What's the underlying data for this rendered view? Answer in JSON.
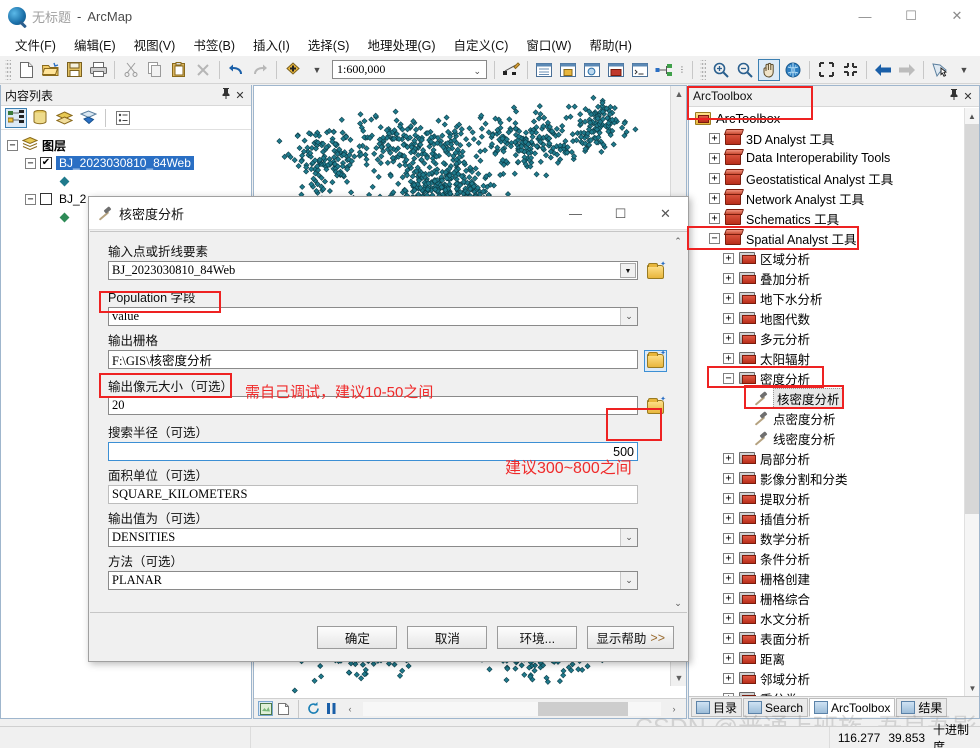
{
  "window": {
    "doc_title": "无标题",
    "app_title": "ArcMap",
    "separator": "-",
    "minimize": "—",
    "maximize": "☐",
    "close": "✕"
  },
  "menubar": {
    "items": [
      {
        "label": "文件(F)"
      },
      {
        "label": "编辑(E)"
      },
      {
        "label": "视图(V)"
      },
      {
        "label": "书签(B)"
      },
      {
        "label": "插入(I)"
      },
      {
        "label": "选择(S)"
      },
      {
        "label": "地理处理(G)"
      },
      {
        "label": "自定义(C)"
      },
      {
        "label": "窗口(W)"
      },
      {
        "label": "帮助(H)"
      }
    ]
  },
  "toolbar": {
    "scale_value": "1:600,000",
    "overflow": "⋮"
  },
  "toc": {
    "title": "内容列表",
    "pin": "📌",
    "close": "✕",
    "root": "图层",
    "layers": [
      {
        "name": "BJ_2023030810_84Web",
        "checked": true,
        "selected": true
      },
      {
        "name": "BJ_2",
        "checked": false,
        "selected": false
      }
    ]
  },
  "map": {
    "bottom_buttons": [
      "layout-view",
      "data-view",
      "refresh",
      "pause"
    ],
    "scroll_left": "‹",
    "scroll_right": "›"
  },
  "arctoolbox": {
    "title": "ArcToolbox",
    "pin": "📌",
    "close": "✕",
    "root": "ArcToolbox",
    "nodes": [
      {
        "label": "3D Analyst 工具",
        "type": "toolbox",
        "indent": 1,
        "expander": "+"
      },
      {
        "label": "Data Interoperability Tools",
        "type": "toolbox",
        "indent": 1,
        "expander": "+"
      },
      {
        "label": "Geostatistical Analyst 工具",
        "type": "toolbox",
        "indent": 1,
        "expander": "+"
      },
      {
        "label": "Network Analyst 工具",
        "type": "toolbox",
        "indent": 1,
        "expander": "+"
      },
      {
        "label": "Schematics 工具",
        "type": "toolbox",
        "indent": 1,
        "expander": "+"
      },
      {
        "label": "Spatial Analyst 工具",
        "type": "toolbox",
        "indent": 1,
        "expander": "-"
      },
      {
        "label": "区域分析",
        "type": "toolset",
        "indent": 2,
        "expander": "+"
      },
      {
        "label": "叠加分析",
        "type": "toolset",
        "indent": 2,
        "expander": "+"
      },
      {
        "label": "地下水分析",
        "type": "toolset",
        "indent": 2,
        "expander": "+"
      },
      {
        "label": "地图代数",
        "type": "toolset",
        "indent": 2,
        "expander": "+"
      },
      {
        "label": "多元分析",
        "type": "toolset",
        "indent": 2,
        "expander": "+"
      },
      {
        "label": "太阳辐射",
        "type": "toolset",
        "indent": 2,
        "expander": "+"
      },
      {
        "label": "密度分析",
        "type": "toolset",
        "indent": 2,
        "expander": "-"
      },
      {
        "label": "核密度分析",
        "type": "tool",
        "indent": 3,
        "expander": "",
        "selected": true
      },
      {
        "label": "点密度分析",
        "type": "tool",
        "indent": 3,
        "expander": ""
      },
      {
        "label": "线密度分析",
        "type": "tool",
        "indent": 3,
        "expander": ""
      },
      {
        "label": "局部分析",
        "type": "toolset",
        "indent": 2,
        "expander": "+"
      },
      {
        "label": "影像分割和分类",
        "type": "toolset",
        "indent": 2,
        "expander": "+"
      },
      {
        "label": "提取分析",
        "type": "toolset",
        "indent": 2,
        "expander": "+"
      },
      {
        "label": "插值分析",
        "type": "toolset",
        "indent": 2,
        "expander": "+"
      },
      {
        "label": "数学分析",
        "type": "toolset",
        "indent": 2,
        "expander": "+"
      },
      {
        "label": "条件分析",
        "type": "toolset",
        "indent": 2,
        "expander": "+"
      },
      {
        "label": "栅格创建",
        "type": "toolset",
        "indent": 2,
        "expander": "+"
      },
      {
        "label": "栅格综合",
        "type": "toolset",
        "indent": 2,
        "expander": "+"
      },
      {
        "label": "水文分析",
        "type": "toolset",
        "indent": 2,
        "expander": "+"
      },
      {
        "label": "表面分析",
        "type": "toolset",
        "indent": 2,
        "expander": "+"
      },
      {
        "label": "距离",
        "type": "toolset",
        "indent": 2,
        "expander": "+"
      },
      {
        "label": "邻域分析",
        "type": "toolset",
        "indent": 2,
        "expander": "+"
      },
      {
        "label": "重分类",
        "type": "toolset",
        "indent": 2,
        "expander": "+"
      }
    ],
    "tabs": [
      {
        "label": "目录",
        "active": false
      },
      {
        "label": "Search",
        "active": false
      },
      {
        "label": "ArcToolbox",
        "active": true
      },
      {
        "label": "结果",
        "active": false
      }
    ]
  },
  "dialog": {
    "title": "核密度分析",
    "minimize": "—",
    "maximize": "☐",
    "close": "✕",
    "fields": [
      {
        "label": "输入点或折线要素",
        "value": "BJ_2023030810_84Web",
        "control": "combo-solid",
        "browse": "normal"
      },
      {
        "label": "Population 字段",
        "value": "value",
        "control": "combo-chev",
        "browse": "none"
      },
      {
        "label": "输出栅格",
        "value": "F:\\GIS\\核密度分析",
        "control": "text",
        "browse": "highlight"
      },
      {
        "label": "输出像元大小（可选）",
        "value": "20",
        "control": "text",
        "browse": "normal"
      },
      {
        "label": "搜索半径（可选）",
        "value": "500",
        "control": "text-right",
        "browse": "none"
      },
      {
        "label": "面积单位（可选）",
        "value": "SQUARE_KILOMETERS",
        "control": "text-flat",
        "browse": "none"
      },
      {
        "label": "输出值为（可选）",
        "value": "DENSITIES",
        "control": "combo-chev",
        "browse": "none"
      },
      {
        "label": "方法（可选）",
        "value": "PLANAR",
        "control": "combo-chev",
        "browse": "none"
      }
    ],
    "buttons": [
      {
        "label": "确定"
      },
      {
        "label": "取消"
      },
      {
        "label": "环境..."
      },
      {
        "label": "显示帮助",
        "suffix": ">>"
      }
    ]
  },
  "annotations": [
    {
      "text": "需自己调试，建议10-50之间"
    },
    {
      "text": "建议300~800之间"
    }
  ],
  "statusbar": {
    "coord_x": "116.277",
    "coord_y": "39.853",
    "unit": "十进制度"
  },
  "watermark": {
    "text": "CSDN @普通上班族_吾良吾影"
  },
  "colors": {
    "accent_red": "#ee2222",
    "selection_blue": "#2a6fc4",
    "point_teal": "#1f7a8c"
  }
}
